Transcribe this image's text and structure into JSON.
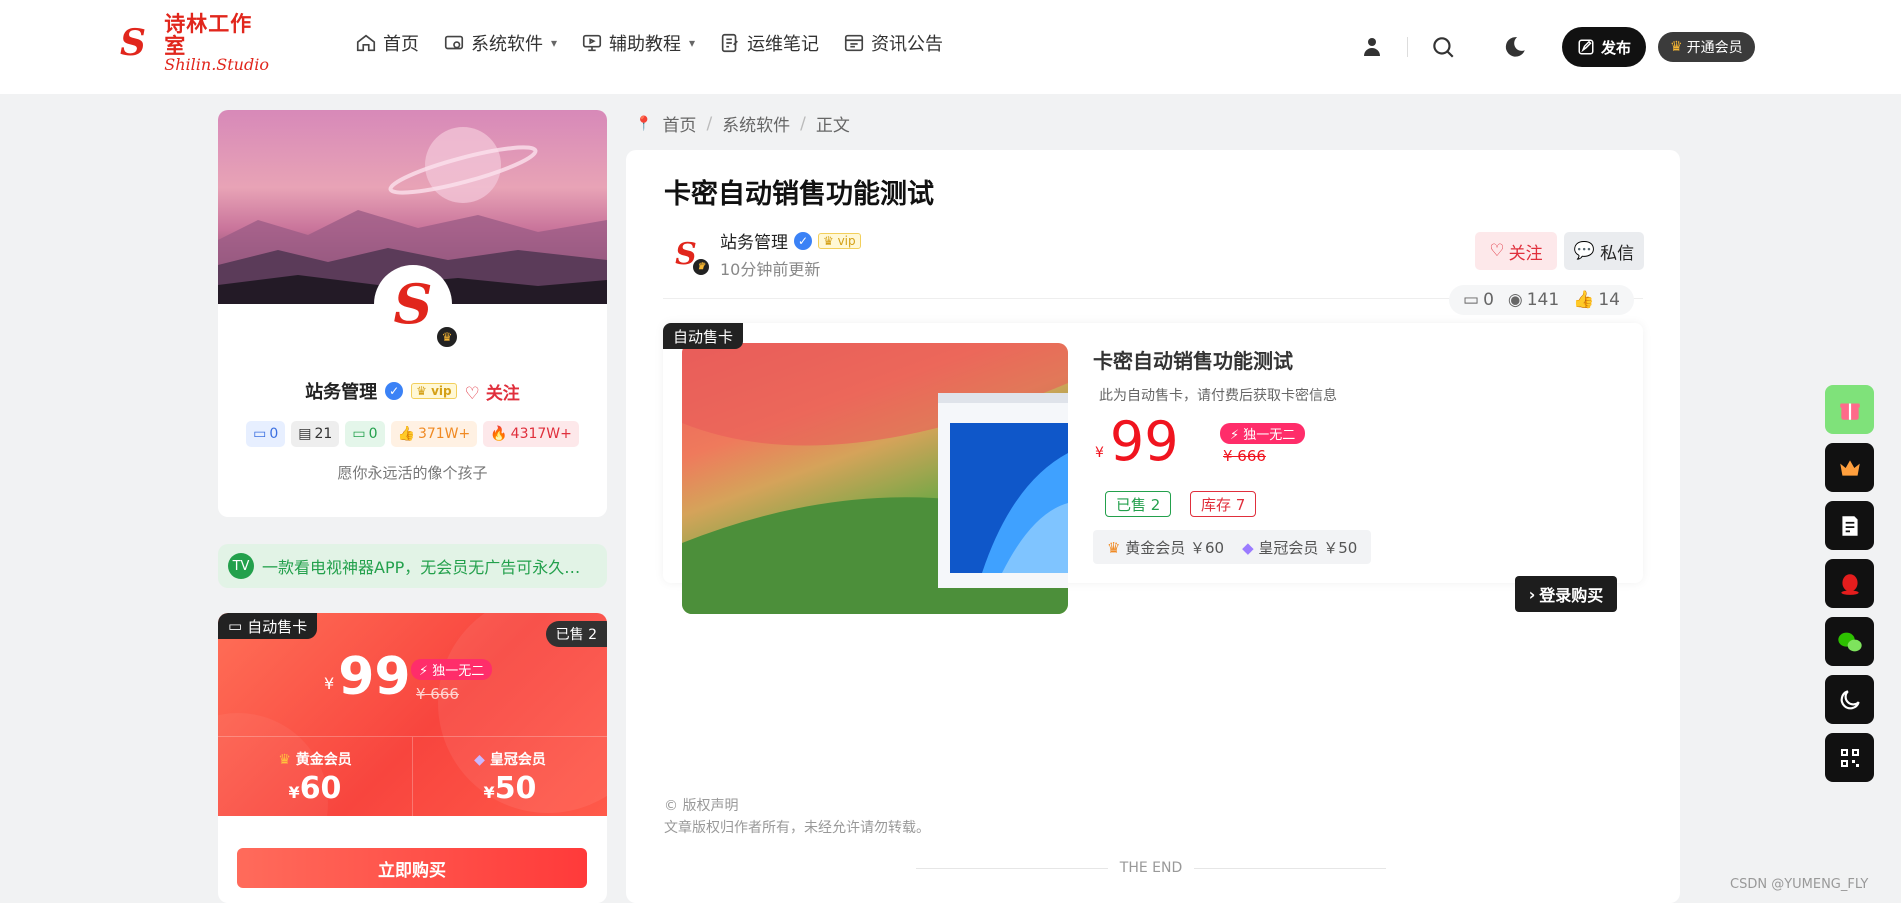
{
  "header": {
    "logo_cn": "诗林工作室",
    "logo_en": "Shilin.Studio",
    "nav": [
      {
        "label": "首页",
        "icon": "home-icon"
      },
      {
        "label": "系统软件",
        "icon": "software-icon",
        "dropdown": true
      },
      {
        "label": "辅助教程",
        "icon": "monitor-icon",
        "dropdown": true
      },
      {
        "label": "运维笔记",
        "icon": "note-icon"
      },
      {
        "label": "资讯公告",
        "icon": "news-icon"
      }
    ],
    "publish_label": "发布",
    "vip_label": "开通会员"
  },
  "sidebar": {
    "profile": {
      "name": "站务管理",
      "follow": "关注",
      "stats": {
        "comments": "0",
        "posts": "21",
        "replies": "0",
        "likes": "371W+",
        "hot": "4317W+"
      },
      "motto": "愿你永远活的像个孩子"
    },
    "notice": "一款看电视神器APP，无会员无广告可永久使用",
    "sale": {
      "tag": "自动售卡",
      "sold": "已售 2",
      "currency": "¥",
      "price": "99",
      "unique": "独一无二",
      "old_price": "¥ 666",
      "tiers": [
        {
          "name": "黄金会员",
          "price": "60"
        },
        {
          "name": "皇冠会员",
          "price": "50"
        }
      ],
      "buy_label": "立即购买"
    }
  },
  "breadcrumb": [
    "首页",
    "系统软件",
    "正文"
  ],
  "article": {
    "title": "卡密自动销售功能测试",
    "author": "站务管理",
    "updated": "10分钟前更新",
    "follow_label": "关注",
    "message_label": "私信",
    "metrics": {
      "comments": "0",
      "views": "141",
      "likes": "14"
    },
    "product": {
      "tag": "自动售卡",
      "title": "卡密自动销售功能测试",
      "desc": "此为自动售卡，请付费后获取卡密信息",
      "currency": "¥",
      "price": "99",
      "unique": "独一无二",
      "old_price": "¥ 666",
      "sold": "已售 2",
      "stock": "库存 7",
      "gold_member": "黄金会员 ￥60",
      "crown_member": "皇冠会员 ￥50",
      "login_buy": "登录购买"
    },
    "copyright_title": "© 版权声明",
    "copyright_text": "文章版权归作者所有，未经允许请勿转载。",
    "the_end": "THE END"
  },
  "watermark": "CSDN @YUMENG_FLY",
  "colors": {
    "accent_red": "#f0141f",
    "brand_red": "#e1261c",
    "green": "#23a04c"
  }
}
